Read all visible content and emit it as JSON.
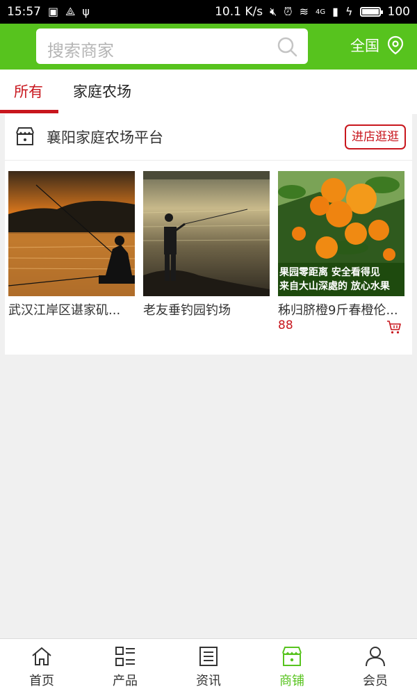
{
  "status_bar": {
    "time": "15:57",
    "speed": "10.1 K/s",
    "network": "4G",
    "battery": "100",
    "battery_level": 1.0
  },
  "header": {
    "search_placeholder": "搜索商家",
    "region_label": "全国"
  },
  "tabs": [
    {
      "label": "所有",
      "active": true
    },
    {
      "label": "家庭农场",
      "active": false
    }
  ],
  "store": {
    "name": "襄阳家庭农场平台",
    "visit_button": "进店逛逛",
    "products": [
      {
        "name": "武汉江岸区谌家矶...",
        "price": ""
      },
      {
        "name": "老友垂钓园钓场",
        "price": ""
      },
      {
        "name": "秭归脐橙9斤春橙伦...",
        "price": "88",
        "image_text_line1": "果园零距离 安全看得见",
        "image_text_line2": "来自大山深處的 放心水果"
      }
    ]
  },
  "bottom_nav": [
    {
      "label": "首页",
      "icon": "home-icon",
      "active": false
    },
    {
      "label": "产品",
      "icon": "product-grid-icon",
      "active": false
    },
    {
      "label": "资讯",
      "icon": "news-icon",
      "active": false
    },
    {
      "label": "商铺",
      "icon": "shop-icon",
      "active": true
    },
    {
      "label": "会员",
      "icon": "user-icon",
      "active": false
    }
  ],
  "colors": {
    "brand_green": "#57c31e",
    "accent_red": "#c8161d"
  }
}
